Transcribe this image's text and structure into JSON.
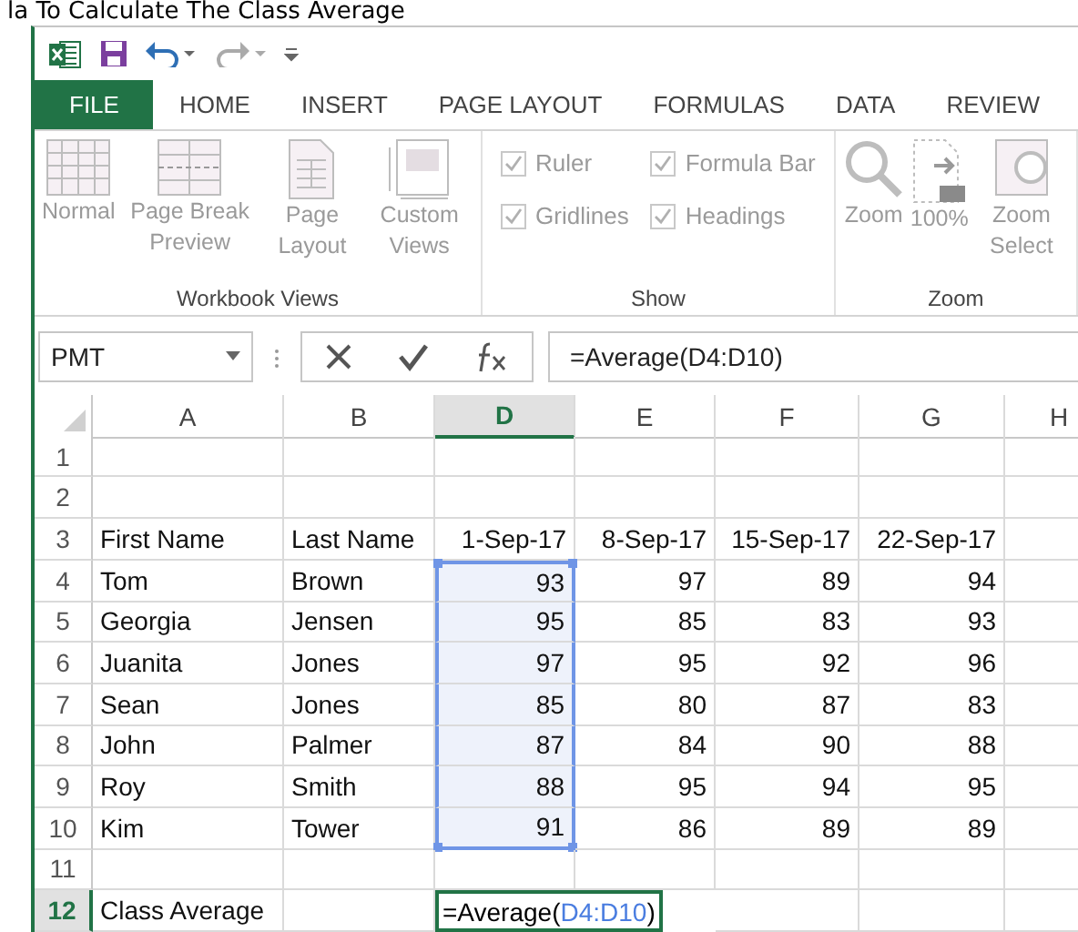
{
  "heading": "la To Calculate The Class Average",
  "quick_access": [
    {
      "kind": "excel"
    },
    {
      "kind": "save"
    },
    {
      "kind": "undo"
    },
    {
      "kind": "redo"
    },
    {
      "kind": "customize"
    }
  ],
  "tabs": [
    {
      "label": "FILE",
      "kind": "file",
      "selected": false
    },
    {
      "label": "HOME",
      "kind": "tab",
      "selected": false
    },
    {
      "label": "INSERT",
      "kind": "tab",
      "selected": false
    },
    {
      "label": "PAGE LAYOUT",
      "kind": "tab",
      "selected": false
    },
    {
      "label": "FORMULAS",
      "kind": "tab",
      "selected": false
    },
    {
      "label": "DATA",
      "kind": "tab",
      "selected": false
    },
    {
      "label": "REVIEW",
      "kind": "tab",
      "selected": false
    }
  ],
  "ribbon": {
    "disabled": true,
    "groups": [
      {
        "label": "Workbook Views",
        "items": [
          {
            "kind": "normal",
            "label": "Normal"
          },
          {
            "kind": "pagebreak",
            "label": "Page Break Preview"
          },
          {
            "kind": "pagelayout",
            "label": "Page Layout"
          },
          {
            "kind": "custom",
            "label": "Custom Views"
          }
        ]
      },
      {
        "label": "Show",
        "checkboxes": [
          {
            "label": "Ruler",
            "checked": true
          },
          {
            "label": "Formula Bar",
            "checked": true
          },
          {
            "label": "Gridlines",
            "checked": true
          },
          {
            "label": "Headings",
            "checked": true
          }
        ]
      },
      {
        "label": "Zoom",
        "items": [
          {
            "kind": "zoom",
            "label": "Zoom"
          },
          {
            "kind": "hundred",
            "label": "100%"
          },
          {
            "kind": "zoomsel",
            "label": "Zoom Select"
          }
        ]
      }
    ]
  },
  "formula_bar": {
    "name_box": "PMT",
    "formula": "=Average(D4:D10)"
  },
  "sheet": {
    "columns": [
      {
        "label": "A",
        "selected": false
      },
      {
        "label": "B",
        "selected": false
      },
      {
        "label": "D",
        "selected": true
      },
      {
        "label": "E",
        "selected": false
      },
      {
        "label": "F",
        "selected": false
      },
      {
        "label": "G",
        "selected": false
      },
      {
        "label": "H",
        "selected": false
      }
    ],
    "rows": [
      {
        "header": "1",
        "selected": false,
        "cells": [
          "",
          "",
          "",
          "",
          "",
          "",
          ""
        ]
      },
      {
        "header": "2",
        "selected": false,
        "cells": [
          "",
          "",
          "",
          "",
          "",
          "",
          ""
        ]
      },
      {
        "header": "3",
        "selected": false,
        "cells": [
          "First Name",
          "Last Name",
          "1-Sep-17",
          "8-Sep-17",
          "15-Sep-17",
          "22-Sep-17",
          ""
        ]
      },
      {
        "header": "4",
        "selected": false,
        "in_range": true,
        "cells": [
          "Tom",
          "Brown",
          "93",
          "97",
          "89",
          "94",
          ""
        ]
      },
      {
        "header": "5",
        "selected": false,
        "in_range": true,
        "cells": [
          "Georgia",
          "Jensen",
          "95",
          "85",
          "83",
          "93",
          ""
        ]
      },
      {
        "header": "6",
        "selected": false,
        "in_range": true,
        "cells": [
          "Juanita",
          "Jones",
          "97",
          "95",
          "92",
          "96",
          ""
        ]
      },
      {
        "header": "7",
        "selected": false,
        "in_range": true,
        "cells": [
          "Sean",
          "Jones",
          "85",
          "80",
          "87",
          "83",
          ""
        ]
      },
      {
        "header": "8",
        "selected": false,
        "in_range": true,
        "cells": [
          "John",
          "Palmer",
          "87",
          "84",
          "90",
          "88",
          ""
        ]
      },
      {
        "header": "9",
        "selected": false,
        "in_range": true,
        "cells": [
          "Roy",
          "Smith",
          "88",
          "95",
          "94",
          "95",
          ""
        ]
      },
      {
        "header": "10",
        "selected": false,
        "in_range": true,
        "cells": [
          "Kim",
          "Tower",
          "91",
          "86",
          "89",
          "89",
          ""
        ]
      },
      {
        "header": "11",
        "selected": false,
        "cells": [
          "",
          "",
          "",
          "",
          "",
          "",
          ""
        ]
      },
      {
        "header": "12",
        "selected": true,
        "cells": [
          "Class Average",
          "",
          "",
          "",
          "",
          "",
          ""
        ],
        "editing": {
          "prefix": "=Average(",
          "reference": "D4:D10",
          "suffix": ")"
        }
      }
    ]
  }
}
